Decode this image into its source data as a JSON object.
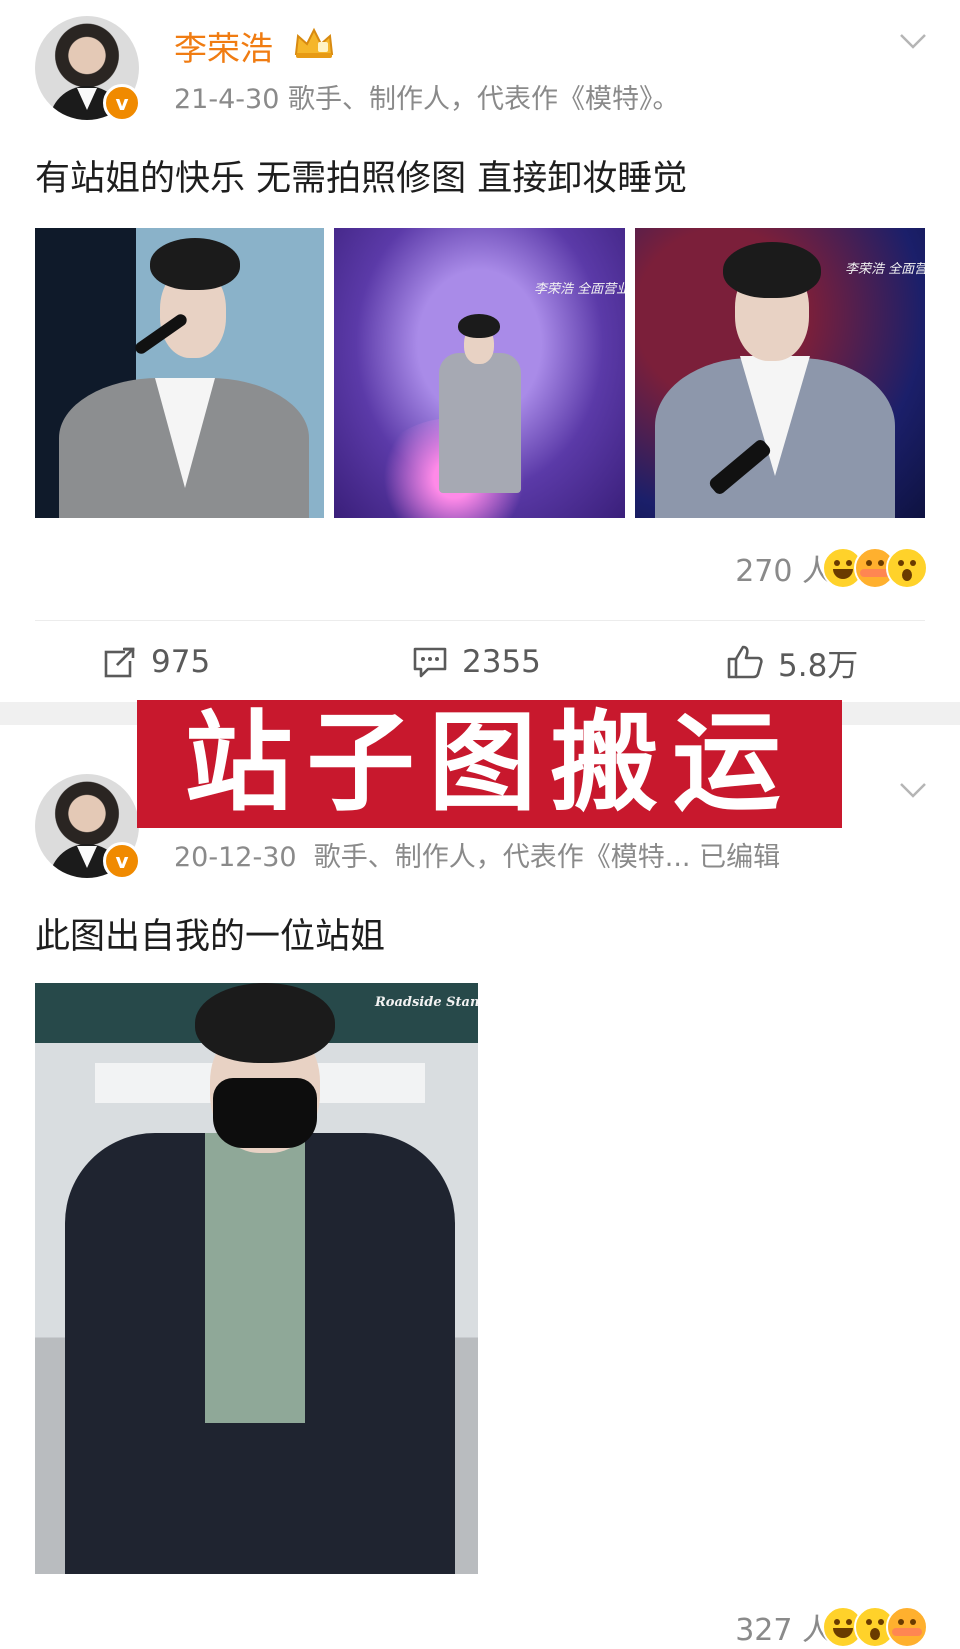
{
  "post1": {
    "author": {
      "name": "李荣浩",
      "verified_badge": "v"
    },
    "meta": "21-4-30  歌手、制作人，代表作《模特》。",
    "text": "有站姐的快乐 无需拍照修图 直接卸妆睡觉",
    "images": [
      {
        "icon": "concert-photo-1"
      },
      {
        "icon": "concert-photo-2",
        "watermark": "李荣浩 全面营业"
      },
      {
        "icon": "concert-photo-3",
        "watermark": "李荣浩 全面营业"
      }
    ],
    "reactions": {
      "count_label": "270 人"
    },
    "actions": {
      "repost": "975",
      "comment": "2355",
      "like": "5.8万"
    }
  },
  "banner": {
    "text": "站子图搬运"
  },
  "post2": {
    "meta_date": "20-12-30",
    "meta_desc": "歌手、制作人，代表作《模特...",
    "meta_edited": "已编辑",
    "text": "此图出自我的一位站姐",
    "image": {
      "watermark": "Roadside Stands"
    },
    "reactions": {
      "count_label": "327 人"
    }
  },
  "colors": {
    "username": "#f07c12",
    "banner": "#c8182d",
    "verified": "#f08a00"
  }
}
